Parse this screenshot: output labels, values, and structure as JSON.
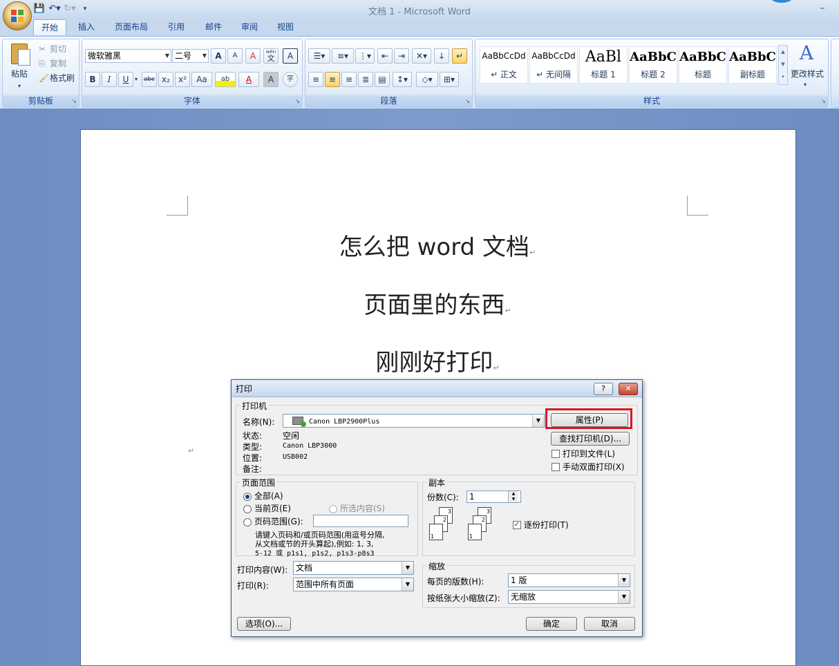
{
  "window": {
    "title": "文档 1 - Microsoft Word",
    "minimize_glyph": "–"
  },
  "qat": {
    "icons": [
      "save-icon",
      "undo-icon",
      "redo-icon",
      "customize-icon"
    ]
  },
  "tabs": [
    {
      "label": "开始",
      "active": true
    },
    {
      "label": "插入"
    },
    {
      "label": "页面布局"
    },
    {
      "label": "引用"
    },
    {
      "label": "邮件"
    },
    {
      "label": "审阅"
    },
    {
      "label": "视图"
    }
  ],
  "clipboard": {
    "title": "剪贴板",
    "paste": "粘贴",
    "cut": "剪切",
    "copy": "复制",
    "format_painter": "格式刷"
  },
  "font": {
    "title": "字体",
    "font_name": "微软雅黑",
    "font_size": "二号",
    "bold": "B",
    "italic": "I",
    "underline": "U",
    "strike": "abc",
    "subscript": "x₂",
    "superscript": "x²",
    "case": "Aa",
    "grow": "A",
    "shrink": "A",
    "clear": "A",
    "phonetic": "wén",
    "phonetic_char": "文",
    "highlight": "ab",
    "color": "A",
    "shade": "A",
    "enclose": "字"
  },
  "paragraph": {
    "title": "段落"
  },
  "styles": {
    "title": "样式",
    "items": [
      {
        "sample": "AaBbCcDd",
        "name": "↵ 正文"
      },
      {
        "sample": "AaBbCcDd",
        "name": "↵ 无间隔"
      },
      {
        "sample": "AaBl",
        "name": "标题 1"
      },
      {
        "sample": "AaBbC",
        "name": "标题 2"
      },
      {
        "sample": "AaBbC",
        "name": "标题"
      },
      {
        "sample": "AaBbC",
        "name": "副标题"
      }
    ],
    "change_styles": "更改样式"
  },
  "document": {
    "lines": [
      "怎么把 word 文档",
      "页面里的东西",
      "刚刚好打印"
    ],
    "paragraph_mark": "↵"
  },
  "print_dialog": {
    "title": "打印",
    "help": "?",
    "close": "✕",
    "printer_group": "打印机",
    "name_label": "名称(N):",
    "printer_name": "Canon LBP2900Plus",
    "properties_button": "属性(P)",
    "find_printer_button": "查找打印机(D)...",
    "status_label": "状态:",
    "status_value": "空闲",
    "type_label": "类型:",
    "type_value": "Canon LBP3000",
    "where_label": "位置:",
    "where_value": "USB002",
    "comment_label": "备注:",
    "print_to_file": "打印到文件(L)",
    "manual_duplex": "手动双面打印(X)",
    "range_group": "页面范围",
    "range_all": "全部(A)",
    "range_current": "当前页(E)",
    "range_selection": "所选内容(S)",
    "range_pages": "页码范围(G):",
    "range_hint_1": "请键入页码和/或页码范围(用逗号分隔,",
    "range_hint_2": "从文档或节的开头算起),例如: 1, 3,",
    "range_hint_3": "5-12 或 p1s1, p1s2, p1s3-p8s3",
    "copies_group": "副本",
    "copies_label": "份数(C):",
    "copies_value": "1",
    "collate": "逐份打印(T)",
    "print_what_label": "打印内容(W):",
    "print_what_value": "文档",
    "print_label": "打印(R):",
    "print_value": "范围中所有页面",
    "zoom_group": "缩放",
    "pages_per_sheet_label": "每页的版数(H):",
    "pages_per_sheet_value": "1 版",
    "scale_label": "按纸张大小缩放(Z):",
    "scale_value": "无缩放",
    "options_button": "选项(O)...",
    "ok_button": "确定",
    "cancel_button": "取消",
    "highlight_color": "#e0141e"
  }
}
